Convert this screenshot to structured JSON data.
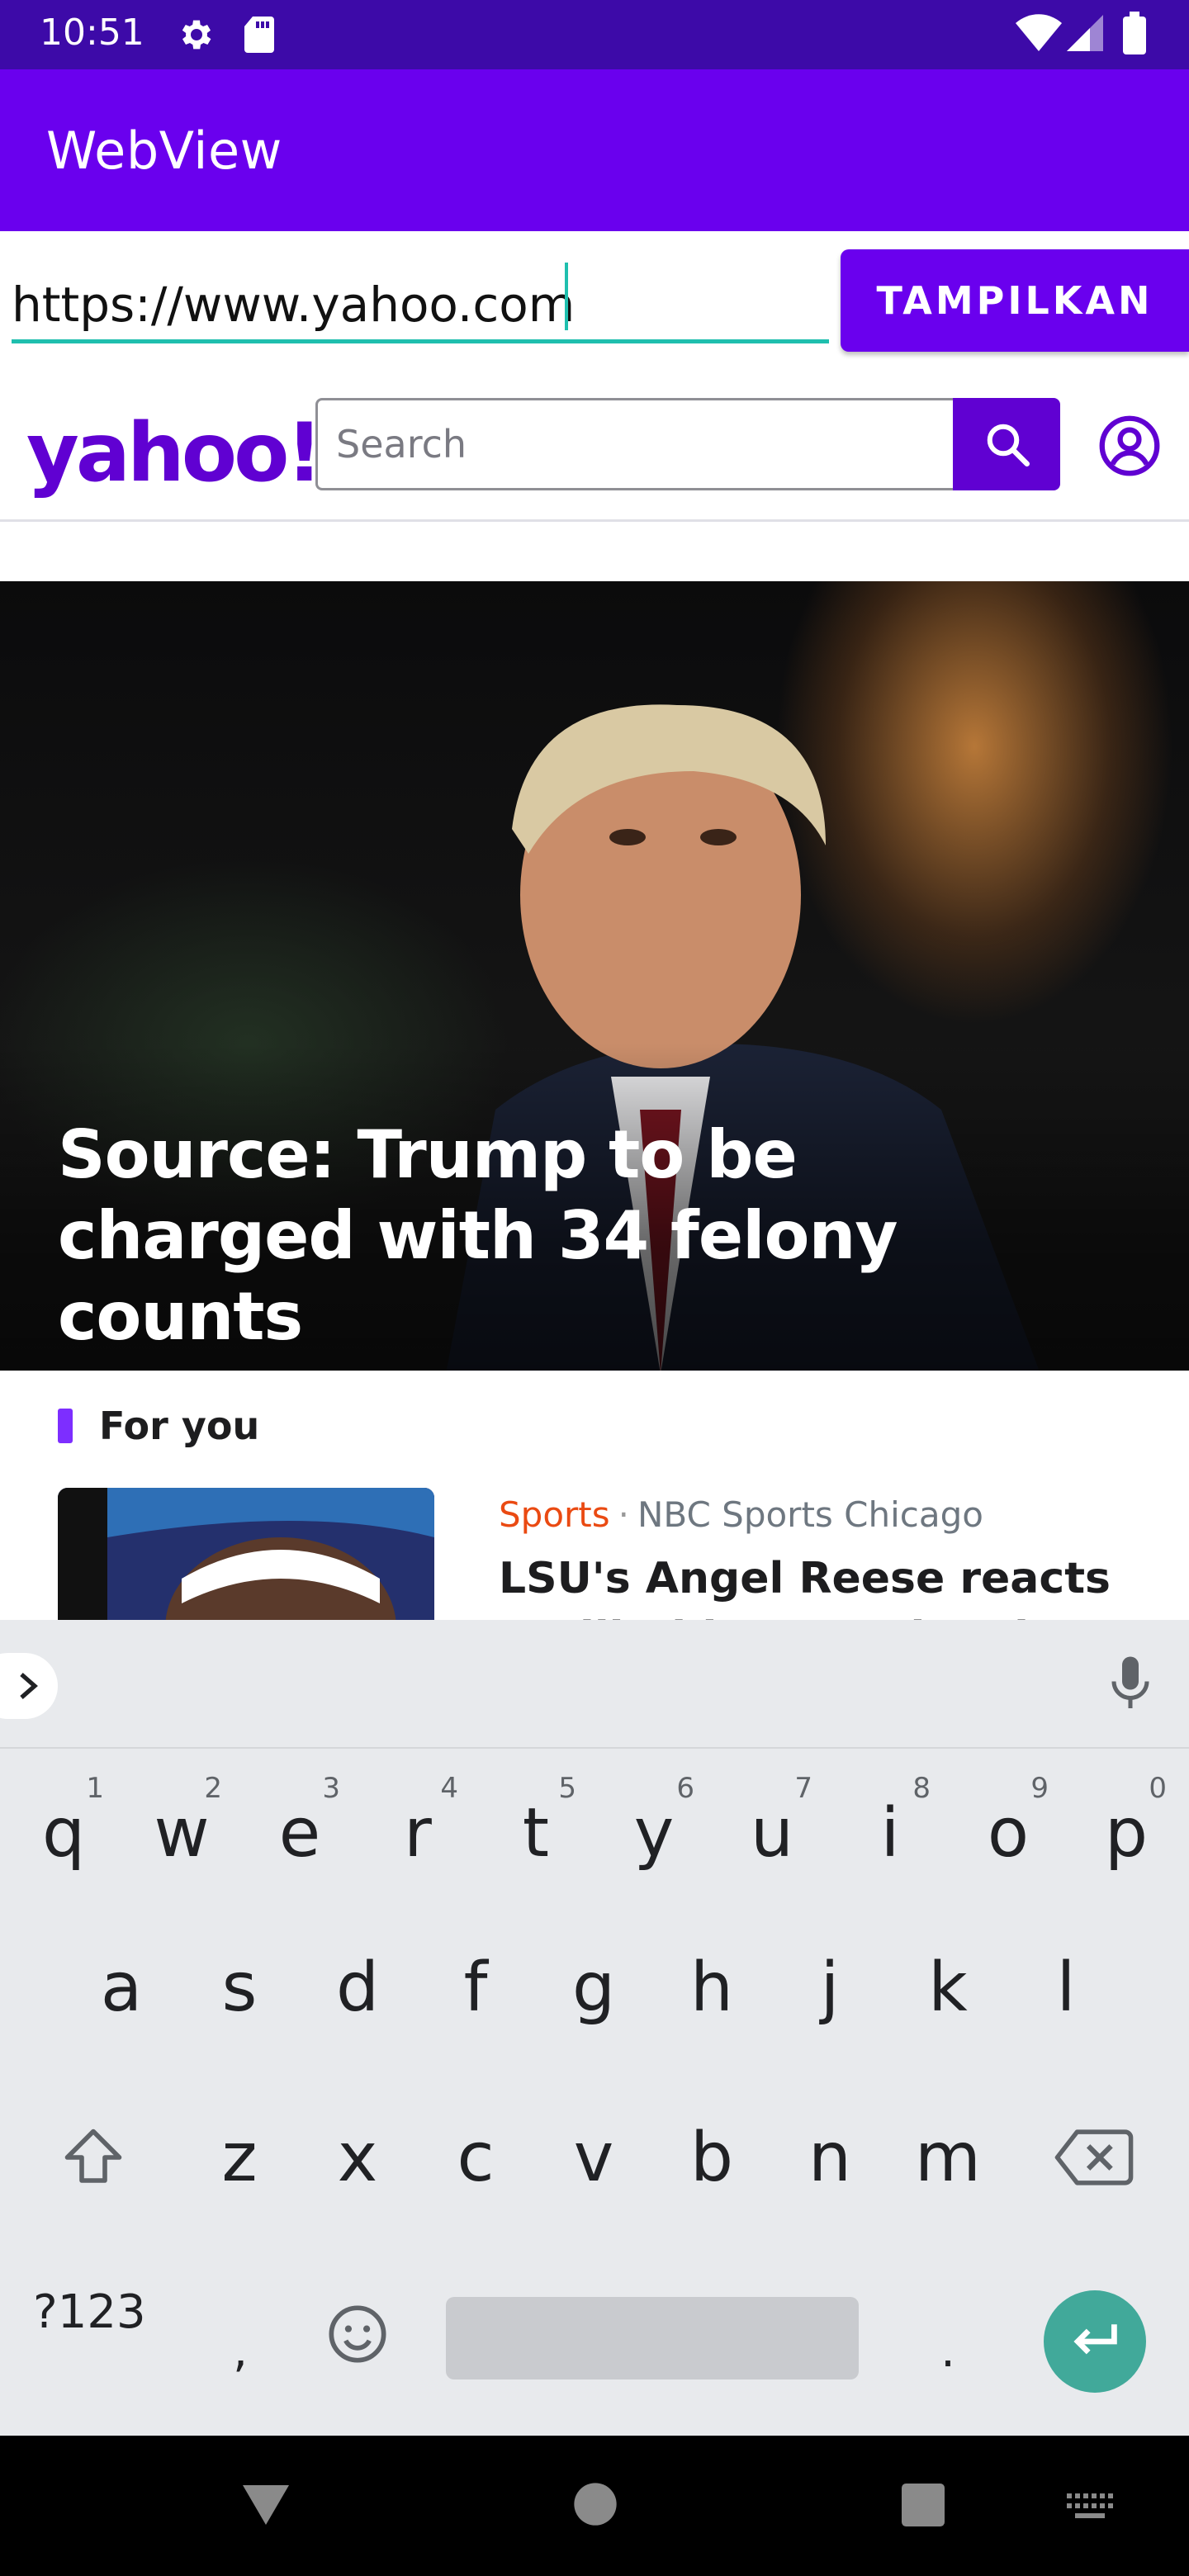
{
  "status_bar": {
    "time": "10:51"
  },
  "app_bar": {
    "title": "WebView"
  },
  "url_bar": {
    "value": "https://www.yahoo.com",
    "button_label": "TAMPILKAN"
  },
  "yahoo": {
    "logo": "yahoo!",
    "search_placeholder": "Search",
    "hero_headline": "Source: Trump to be charged with 34 felony counts",
    "section_title": "For you",
    "story": {
      "category": "Sports",
      "separator": "·",
      "source": "NBC Sports Chicago",
      "title": "LSU's Angel Reese reacts to Jill Biden's national champ invite"
    }
  },
  "keyboard": {
    "row1": [
      {
        "key": "q",
        "hint": "1"
      },
      {
        "key": "w",
        "hint": "2"
      },
      {
        "key": "e",
        "hint": "3"
      },
      {
        "key": "r",
        "hint": "4"
      },
      {
        "key": "t",
        "hint": "5"
      },
      {
        "key": "y",
        "hint": "6"
      },
      {
        "key": "u",
        "hint": "7"
      },
      {
        "key": "i",
        "hint": "8"
      },
      {
        "key": "o",
        "hint": "9"
      },
      {
        "key": "p",
        "hint": "0"
      }
    ],
    "row2": [
      "a",
      "s",
      "d",
      "f",
      "g",
      "h",
      "j",
      "k",
      "l"
    ],
    "row3": [
      "z",
      "x",
      "c",
      "v",
      "b",
      "n",
      "m"
    ],
    "symbols_key": "?123",
    "comma_key": ",",
    "period_key": "."
  },
  "colors": {
    "status_bar": "#3d0aa8",
    "app_bar": "#6a00ee",
    "url_underline": "#1fbfae",
    "yahoo_purple": "#6001d2",
    "category_orange": "#ea4a12",
    "enter_key": "#41a99a"
  },
  "icons": {
    "status": [
      "settings-icon",
      "sd-card-icon",
      "wifi-icon",
      "signal-icon",
      "battery-icon"
    ],
    "yahoo": [
      "search-icon",
      "profile-icon"
    ],
    "keyboard": [
      "expand-chevron-icon",
      "mic-icon",
      "shift-icon",
      "backspace-icon",
      "emoji-icon",
      "enter-icon"
    ],
    "nav": [
      "back-icon",
      "home-icon",
      "recents-icon",
      "keyboard-switch-icon"
    ]
  }
}
